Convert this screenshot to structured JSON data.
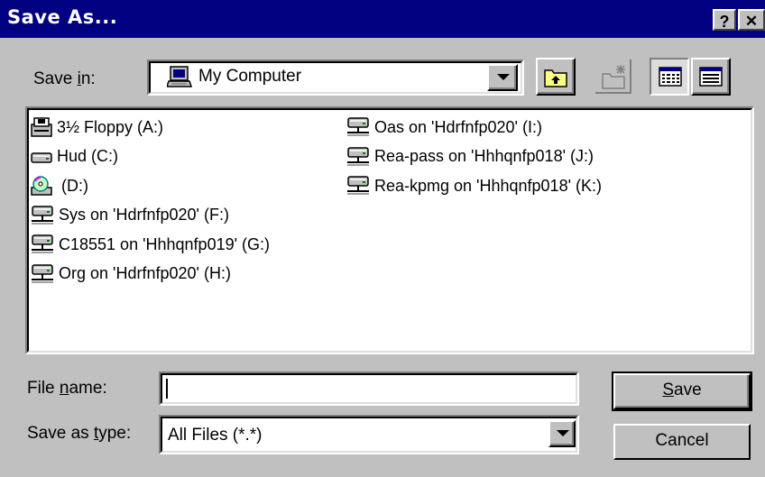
{
  "window": {
    "title": "Save As...",
    "help_label": "?",
    "close_label": "✕"
  },
  "save_in": {
    "label_prefix": "Save ",
    "label_key": "i",
    "label_suffix": "n:",
    "value": "My Computer"
  },
  "toolbar": [
    "up-one-level",
    "create-new-folder",
    "list-view",
    "details-view"
  ],
  "files": {
    "column1": [
      {
        "name": "3½ Floppy (A:)",
        "icon": "floppy-drive-icon"
      },
      {
        "name": "Hud (C:)",
        "icon": "hard-drive-icon"
      },
      {
        "name": " (D:)",
        "icon": "cd-drive-icon"
      },
      {
        "name": "Sys on 'Hdrfnfp020' (F:)",
        "icon": "network-drive-icon"
      },
      {
        "name": "C18551 on 'Hhhqnfp019' (G:)",
        "icon": "network-drive-icon"
      },
      {
        "name": "Org on 'Hdrfnfp020' (H:)",
        "icon": "network-drive-icon"
      }
    ],
    "column2": [
      {
        "name": "Oas on 'Hdrfnfp020' (I:)",
        "icon": "network-drive-icon"
      },
      {
        "name": "Rea-pass on 'Hhhqnfp018' (J:)",
        "icon": "network-drive-icon"
      },
      {
        "name": "Rea-kpmg on 'Hhhqnfp018' (K:)",
        "icon": "network-drive-icon"
      }
    ]
  },
  "file_name": {
    "label_prefix": "File ",
    "label_key": "n",
    "label_suffix": "ame:",
    "value": ""
  },
  "save_as_type": {
    "label_prefix": "Save as ",
    "label_key": "t",
    "label_suffix": "ype:",
    "value": "All Files (*.*)"
  },
  "buttons": {
    "save_key": "S",
    "save_rest": "ave",
    "cancel": "Cancel"
  }
}
